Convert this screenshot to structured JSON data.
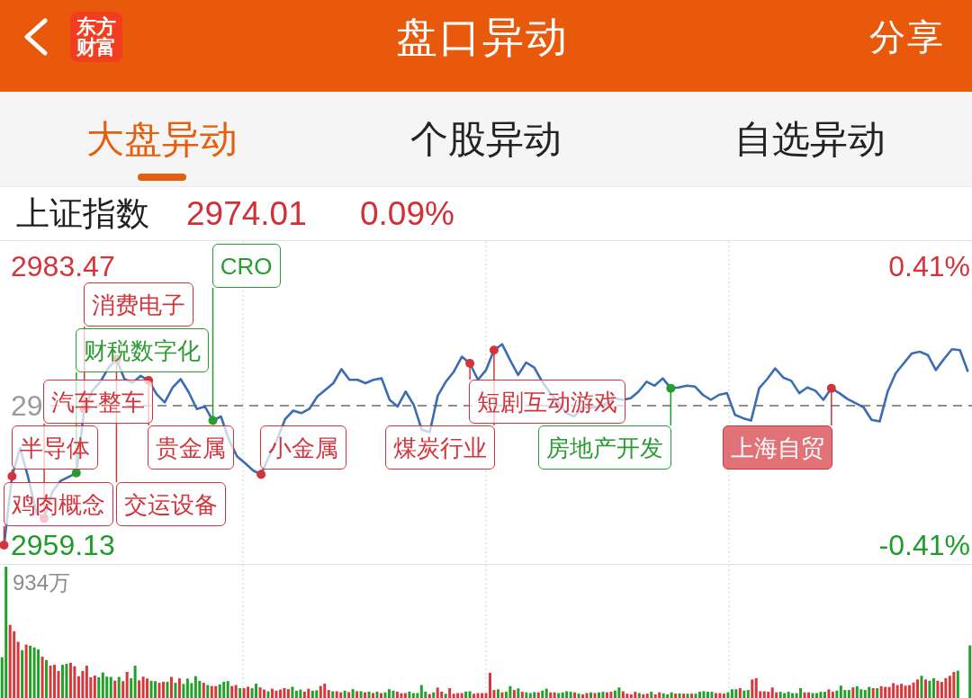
{
  "header": {
    "logo": "东方财富",
    "title": "盘口异动",
    "share": "分享"
  },
  "tabs": [
    {
      "label": "大盘异动",
      "selected": true
    },
    {
      "label": "个股异动",
      "selected": false
    },
    {
      "label": "自选异动",
      "selected": false
    }
  ],
  "index_quote": {
    "name": "上证指数",
    "price": "2974.01",
    "change": "0.09%"
  },
  "price_chart": {
    "high_label": "2983.47",
    "baseline_label": "29",
    "low_label": "2959.13",
    "change_high": "0.41%",
    "change_low": "-0.41%",
    "events": [
      {
        "label": "CRO",
        "color": "#2a9b30",
        "selected": false
      },
      {
        "label": "消费电子",
        "color": "#d3343b",
        "selected": false
      },
      {
        "label": "财税数字化",
        "color": "#2a9b30",
        "selected": false
      },
      {
        "label": "汽车整车",
        "color": "#d3343b",
        "selected": false
      },
      {
        "label": "短剧互动游戏",
        "color": "#d3343b",
        "selected": false
      },
      {
        "label": "半导体",
        "color": "#d3343b",
        "selected": false
      },
      {
        "label": "贵金属",
        "color": "#d3343b",
        "selected": false
      },
      {
        "label": "小金属",
        "color": "#d3343b",
        "selected": false
      },
      {
        "label": "煤炭行业",
        "color": "#d3343b",
        "selected": false
      },
      {
        "label": "房地产开发",
        "color": "#2a9b30",
        "selected": false
      },
      {
        "label": "上海自贸",
        "color": "#d3343b",
        "selected": true
      },
      {
        "label": "鸡肉概念",
        "color": "#d3343b",
        "selected": false
      },
      {
        "label": "交运设备",
        "color": "#d3343b",
        "selected": false
      }
    ]
  },
  "volume_chart": {
    "max_label": "934万"
  }
}
